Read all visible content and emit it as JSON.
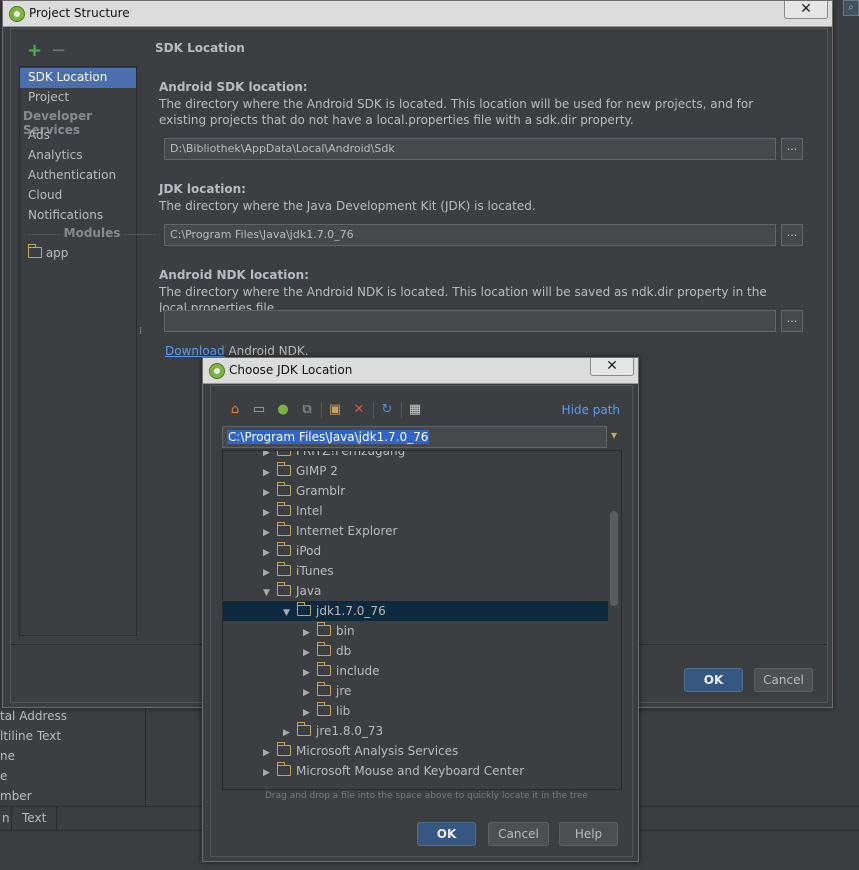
{
  "background": {
    "palette_items": [
      "tal Address",
      "ltiline Text",
      "ne",
      "e",
      "mber"
    ],
    "tabs": [
      "n",
      "Text"
    ]
  },
  "project_structure": {
    "title": "Project Structure",
    "close": "✕",
    "toolbar": {
      "add": "+",
      "remove": "−"
    },
    "sidebar": {
      "items": [
        "SDK Location",
        "Project"
      ],
      "developer_services_label": "Developer Services",
      "services": [
        "Ads",
        "Analytics",
        "Authentication",
        "Cloud",
        "Notifications"
      ],
      "modules_label": "Modules",
      "modules": [
        "app"
      ]
    },
    "section_title": "SDK Location",
    "android_sdk": {
      "label": "Android SDK location:",
      "description": "The directory where the Android SDK is located. This location will be used for new projects, and for existing projects that do not have a local.properties file with a sdk.dir property.",
      "value": "D:\\Bibliothek\\AppData\\Local\\Android\\Sdk"
    },
    "jdk": {
      "label": "JDK location:",
      "description": "The directory where the Java Development Kit (JDK) is located.",
      "value": "C:\\Program Files\\Java\\jdk1.7.0_76"
    },
    "ndk": {
      "label": "Android NDK location:",
      "description": "The directory where the Android NDK is located. This location will be saved as ndk.dir property in the local.properties file.",
      "value": "",
      "download_link": "Download",
      "download_suffix": " Android NDK."
    },
    "browse_label": "...",
    "ok": "OK",
    "cancel": "Cancel"
  },
  "choose_jdk": {
    "title": "Choose JDK Location",
    "close": "✕",
    "hide_path": "Hide path",
    "path": "C:\\Program Files\\Java\\jdk1.7.0_76",
    "tree": {
      "partial_top": "FRITZ!Fernzugang",
      "items": [
        "GIMP 2",
        "Gramblr",
        "Intel",
        "Internet Explorer",
        "iPod",
        "iTunes",
        "Java",
        "jdk1.7.0_76",
        "bin",
        "db",
        "include",
        "jre",
        "lib",
        "jre1.8.0_73",
        "Microsoft Analysis Services",
        "Microsoft Mouse and Keyboard Center"
      ]
    },
    "hint": "Drag and drop a file into the space above to quickly locate it in the tree",
    "ok": "OK",
    "cancel": "Cancel",
    "help": "Help"
  }
}
